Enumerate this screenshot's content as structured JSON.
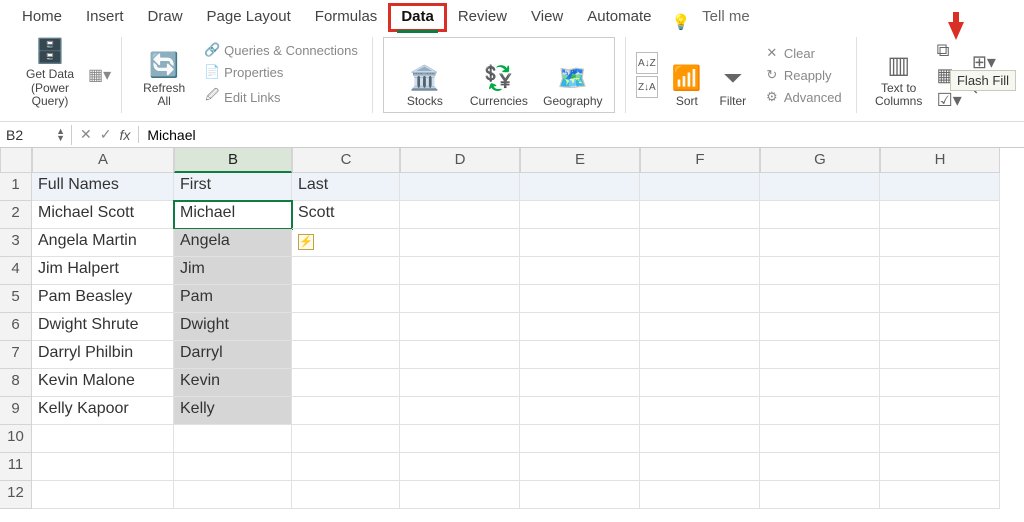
{
  "tabs": [
    "Home",
    "Insert",
    "Draw",
    "Page Layout",
    "Formulas",
    "Data",
    "Review",
    "View",
    "Automate"
  ],
  "active_tab": "Data",
  "tellme": "Tell me",
  "ribbon": {
    "get_data": "Get Data (Power\nQuery)",
    "refresh": "Refresh\nAll",
    "queries": "Queries & Connections",
    "properties": "Properties",
    "editlinks": "Edit Links",
    "stocks": "Stocks",
    "currencies": "Currencies",
    "geography": "Geography",
    "sort": "Sort",
    "filter": "Filter",
    "clear": "Clear",
    "reapply": "Reapply",
    "advanced": "Advanced",
    "text_to_columns": "Text to\nColumns",
    "flash_fill_tooltip": "Flash Fill"
  },
  "name_box": "B2",
  "formula_value": "Michael",
  "columns": [
    "A",
    "B",
    "C",
    "D",
    "E",
    "F",
    "G",
    "H"
  ],
  "rows": [
    1,
    2,
    3,
    4,
    5,
    6,
    7,
    8,
    9,
    10,
    11,
    12
  ],
  "headers": {
    "A": "Full Names",
    "B": "First",
    "C": "Last"
  },
  "data": [
    {
      "A": "Michael Scott",
      "B": "Michael",
      "C": "Scott"
    },
    {
      "A": "Angela Martin",
      "B": "Angela",
      "C": ""
    },
    {
      "A": "Jim Halpert",
      "B": "Jim",
      "C": ""
    },
    {
      "A": "Pam Beasley",
      "B": "Pam",
      "C": ""
    },
    {
      "A": "Dwight Shrute",
      "B": "Dwight",
      "C": ""
    },
    {
      "A": "Darryl Philbin",
      "B": "Darryl",
      "C": ""
    },
    {
      "A": "Kevin Malone",
      "B": "Kevin",
      "C": ""
    },
    {
      "A": "Kelly Kapoor",
      "B": "Kelly",
      "C": ""
    }
  ],
  "selected_column": "B",
  "active_cell": "B2",
  "flash_range": {
    "col": "B",
    "from": 2,
    "to": 9
  },
  "ff_marker_cell": "C3"
}
